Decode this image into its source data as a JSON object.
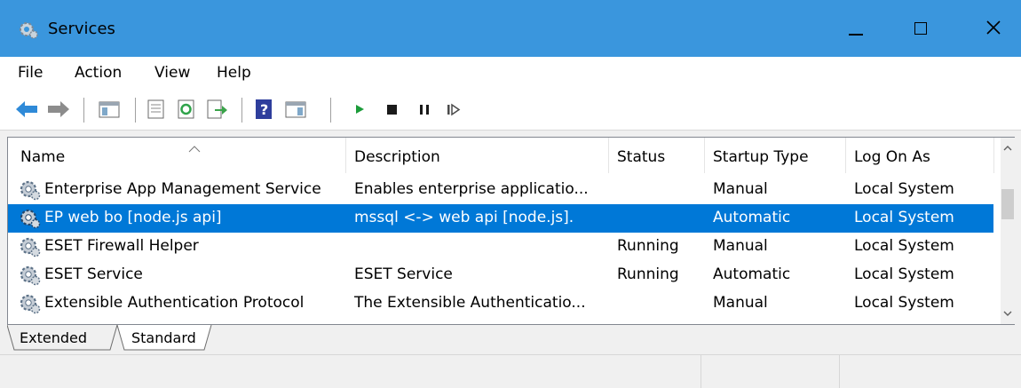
{
  "window": {
    "title": "Services",
    "accent_color": "#3a96dd",
    "icon": "gears-icon"
  },
  "caption_buttons": [
    "minimize-icon",
    "maximize-icon",
    "close-icon"
  ],
  "menu": [
    "File",
    "Action",
    "View",
    "Help"
  ],
  "toolbar": [
    "back-arrow-icon",
    "forward-arrow-icon",
    "show-hide-console-tree-icon",
    "properties-icon",
    "refresh-icon",
    "export-list-icon",
    "help-icon",
    "show-hide-action-pane-icon",
    "start-service-icon",
    "stop-service-icon",
    "pause-service-icon",
    "restart-service-icon"
  ],
  "columns": [
    "Name",
    "Description",
    "Status",
    "Startup Type",
    "Log On As"
  ],
  "services": [
    {
      "name": "Enterprise App Management Service",
      "description": "Enables enterprise applicatio...",
      "status": "",
      "startup": "Manual",
      "logon": "Local System",
      "selected": false
    },
    {
      "name": "EP web bo [node.js api]",
      "description": "mssql <-> web api [node.js].",
      "status": "",
      "startup": "Automatic",
      "logon": "Local System",
      "selected": true
    },
    {
      "name": "ESET Firewall Helper",
      "description": "",
      "status": "Running",
      "startup": "Manual",
      "logon": "Local System",
      "selected": false
    },
    {
      "name": "ESET Service",
      "description": "ESET Service",
      "status": "Running",
      "startup": "Automatic",
      "logon": "Local System",
      "selected": false
    },
    {
      "name": "Extensible Authentication Protocol",
      "description": "The Extensible Authenticatio...",
      "status": "",
      "startup": "Manual",
      "logon": "Local System",
      "selected": false
    }
  ],
  "tabs": [
    {
      "label": "Extended",
      "active": false
    },
    {
      "label": "Standard",
      "active": true
    }
  ],
  "selection_color": "#0078d7"
}
